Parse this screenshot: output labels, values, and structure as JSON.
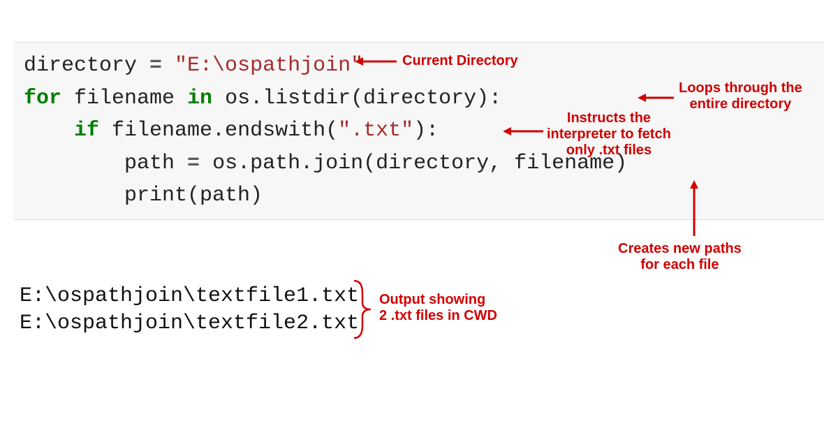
{
  "code": {
    "l1_a": "directory ",
    "l1_eq": "= ",
    "l1_str": "\"E:\\ospathjoin\"",
    "l2_for": "for",
    "l2_a": " filename ",
    "l2_in": "in",
    "l2_b": " os.listdir(directory):",
    "l3_pad": "    ",
    "l3_if": "if",
    "l3_a": " filename.endswith(",
    "l3_str": "\".txt\"",
    "l3_b": "):",
    "l4_pad": "        ",
    "l4_a": "path ",
    "l4_eq": "= ",
    "l4_b": "os.path.join(directory, filename)",
    "l5_pad": "        ",
    "l5_fn": "print",
    "l5_a": "(path)"
  },
  "output": {
    "l1": "E:\\ospathjoin\\textfile1.txt",
    "l2": "E:\\ospathjoin\\textfile2.txt"
  },
  "annotations": {
    "a1": "Current Directory",
    "a2": "Loops through the\nentire directory",
    "a3": "Instructs the\ninterpreter to fetch\nonly .txt files",
    "a4": "Creates new paths\nfor each file",
    "a5": "Output showing\n2 .txt files in CWD"
  }
}
